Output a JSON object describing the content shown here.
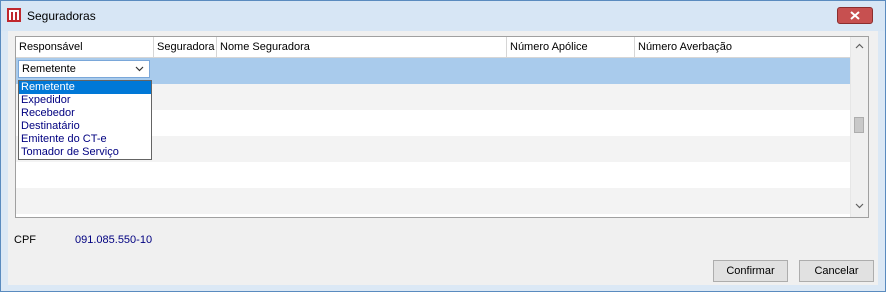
{
  "window": {
    "title": "Seguradoras"
  },
  "grid": {
    "columns": [
      "Responsável",
      "Seguradora",
      "Nome Seguradora",
      "Número Apólice",
      "Número Averbação"
    ],
    "combo_value": "Remetente",
    "dropdown_options": [
      "Remetente",
      "Expedidor",
      "Recebedor",
      "Destinatário",
      "Emitente do CT-e",
      "Tomador de Serviço"
    ],
    "selected_option_index": 0
  },
  "cpf": {
    "label": "CPF",
    "value": "091.085.550-10"
  },
  "buttons": {
    "confirm": "Confirmar",
    "cancel": "Cancelar"
  },
  "colors": {
    "selection": "#a9cbec",
    "highlight": "#0078d7",
    "link": "#000080",
    "close": "#c75050"
  }
}
